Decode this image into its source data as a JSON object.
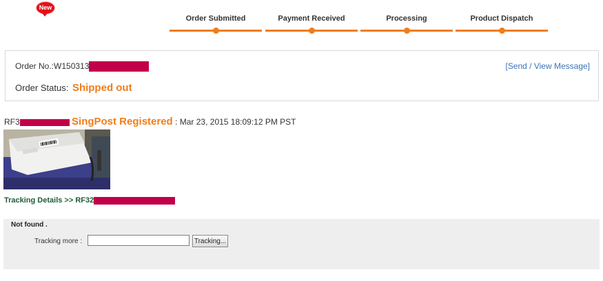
{
  "header": {
    "new_badge": "New"
  },
  "progress": {
    "steps": [
      {
        "label": "Order Submitted"
      },
      {
        "label": "Payment Received"
      },
      {
        "label": "Processing"
      },
      {
        "label": "Product Dispatch"
      }
    ],
    "color": "#f07d1a"
  },
  "order": {
    "number_label": "Order No.:",
    "number_visible": "W150313",
    "status_label": "Order Status:",
    "status_value": "Shipped out",
    "message_link": "[Send / View Message]"
  },
  "shipment": {
    "tracking_prefix": "RF3",
    "carrier": "SingPost Registered",
    "separator": ":",
    "datetime": "Mar 23, 2015 18:09:12 PM PST"
  },
  "tracking": {
    "details_label": "Tracking Details >>",
    "tracking_prefix": "RF32",
    "status": "Not found .",
    "more_label": "Tracking more :",
    "input_value": "",
    "button_label": "Tracking..."
  },
  "colors": {
    "accent": "#f07d1a",
    "redaction": "#c2004a",
    "link": "#3a74b8"
  }
}
